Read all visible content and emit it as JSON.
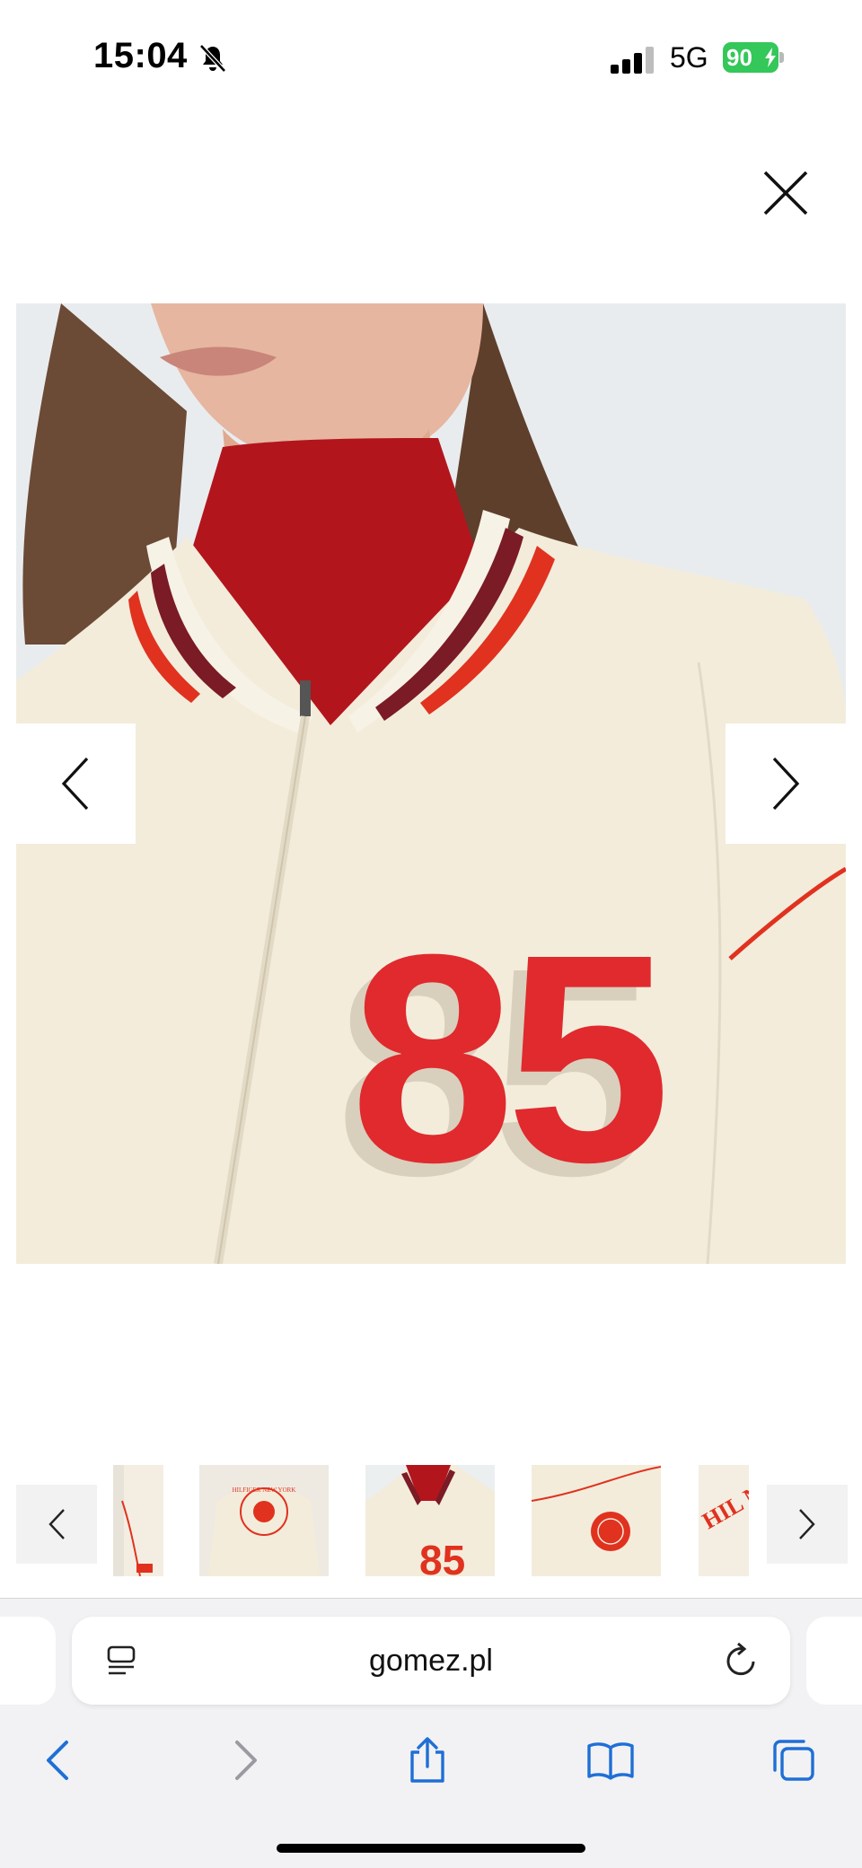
{
  "status_bar": {
    "time": "15:04",
    "network": "5G",
    "battery_percent": "90",
    "battery_level": 0.9,
    "battery_color": "#34c759",
    "icons": [
      "bell-slash-icon",
      "signal-bars-icon",
      "battery-charging-icon"
    ]
  },
  "gallery": {
    "close_icon": "close-icon",
    "prev_icon": "chevron-left-icon",
    "next_icon": "chevron-right-icon",
    "main_image": {
      "description_icon": "product-photo",
      "jersey_number": "85"
    },
    "thumbnails": [
      {
        "name": "thumbnail-1",
        "selected": false
      },
      {
        "name": "thumbnail-2",
        "badge_text": "HILFIGER NEW YORK",
        "selected": false
      },
      {
        "name": "thumbnail-3",
        "badge_text": "85",
        "selected": true
      },
      {
        "name": "thumbnail-4",
        "selected": false
      },
      {
        "name": "thumbnail-5",
        "badge_text": "HIL NEW",
        "selected": false
      }
    ]
  },
  "browser": {
    "url": "gomez.pl",
    "toolbar": {
      "back_icon": "back-arrow-icon",
      "forward_icon": "forward-arrow-icon",
      "share_icon": "share-icon",
      "bookmarks_icon": "book-icon",
      "tabs_icon": "tabs-icon"
    },
    "accent_color": "#1f6fd6"
  }
}
